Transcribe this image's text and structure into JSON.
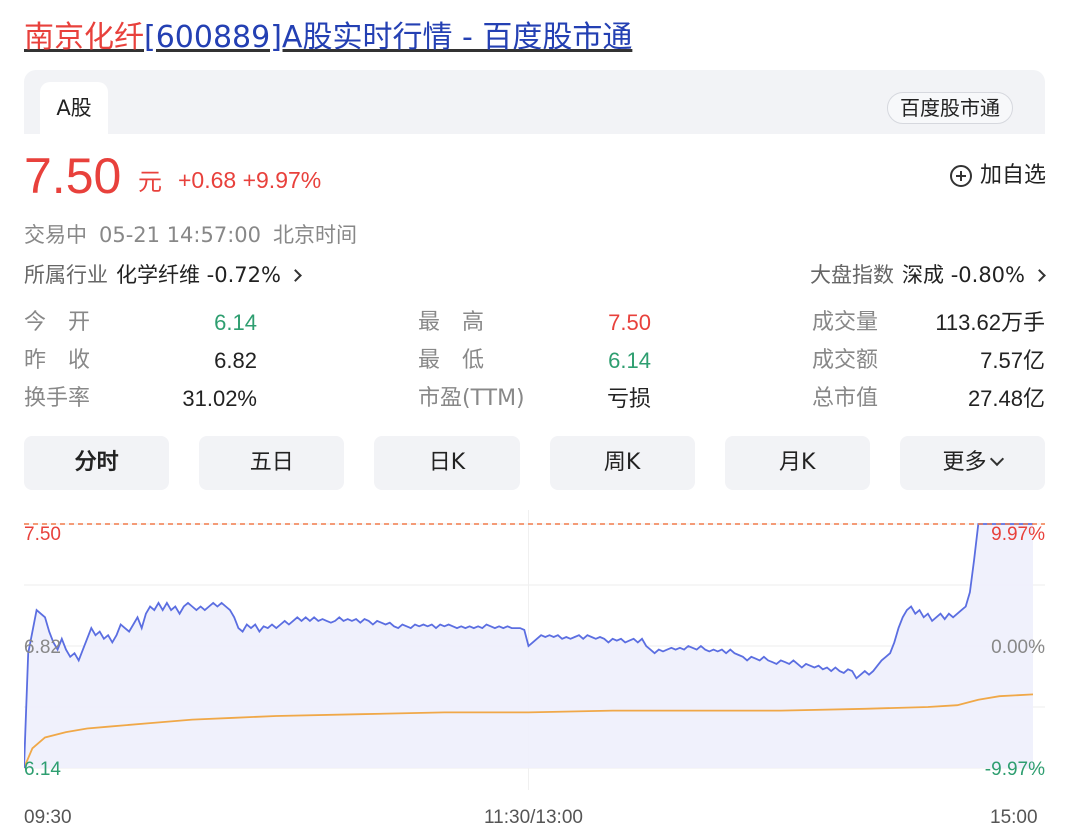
{
  "header": {
    "title_red": "南京化纤",
    "title_blue": "[600889]A股实时行情 - 百度股市通"
  },
  "card": {
    "tab_label": "A股",
    "brand_label": "百度股市通"
  },
  "quote": {
    "price": "7.50",
    "unit": "元",
    "change": "+0.68 +9.97%",
    "add_watch_label": "加自选"
  },
  "status": {
    "state": "交易中",
    "datetime": "05-21 14:57:00",
    "timezone": "北京时间"
  },
  "industry": {
    "label": "所属行业",
    "value": "化学纤维 -0.72%"
  },
  "index": {
    "label": "大盘指数",
    "value": "深成 -0.80%"
  },
  "stats": [
    [
      {
        "label": "今　开",
        "value": "6.14",
        "tone": "green"
      },
      {
        "label": "最　高",
        "value": "7.50",
        "tone": "red"
      },
      {
        "label": "成交量",
        "value": "113.62万手",
        "tone": "dark"
      }
    ],
    [
      {
        "label": "昨　收",
        "value": "6.82",
        "tone": "dark"
      },
      {
        "label": "最　低",
        "value": "6.14",
        "tone": "green"
      },
      {
        "label": "成交额",
        "value": "7.57亿",
        "tone": "dark"
      }
    ],
    [
      {
        "label": "换手率",
        "value": "31.02%",
        "tone": "dark"
      },
      {
        "label": "市盈(TTM)",
        "value": "亏损",
        "tone": "dark"
      },
      {
        "label": "总市值",
        "value": "27.48亿",
        "tone": "dark"
      }
    ]
  ],
  "period_tabs": [
    "分时",
    "五日",
    "日K",
    "周K",
    "月K",
    "更多"
  ],
  "chart_data": {
    "type": "line",
    "y_left_labels": {
      "high": "7.50",
      "mid": "6.82",
      "low": "6.14"
    },
    "y_right_labels": {
      "high": "9.97%",
      "mid": "0.00%",
      "low": "-9.97%"
    },
    "x_labels": [
      "09:30",
      "11:30/13:00",
      "15:00"
    ],
    "ylim": [
      6.14,
      7.5
    ],
    "prev_close": 6.82,
    "x_range": [
      0,
      240
    ],
    "grid": true,
    "series": [
      {
        "values": [
          [
            0,
            6.14
          ],
          [
            1,
            6.78
          ],
          [
            3,
            7.02
          ],
          [
            5,
            6.98
          ],
          [
            6,
            6.9
          ],
          [
            7,
            6.84
          ],
          [
            8,
            6.8
          ],
          [
            9,
            6.86
          ],
          [
            10,
            6.8
          ],
          [
            11,
            6.76
          ],
          [
            12,
            6.78
          ],
          [
            13,
            6.74
          ],
          [
            14,
            6.8
          ],
          [
            15,
            6.86
          ],
          [
            16,
            6.92
          ],
          [
            17,
            6.88
          ],
          [
            18,
            6.9
          ],
          [
            19,
            6.86
          ],
          [
            20,
            6.88
          ],
          [
            21,
            6.84
          ],
          [
            22,
            6.88
          ],
          [
            23,
            6.94
          ],
          [
            24,
            6.92
          ],
          [
            25,
            6.9
          ],
          [
            26,
            6.94
          ],
          [
            27,
            6.98
          ],
          [
            28,
            6.92
          ],
          [
            29,
            7.0
          ],
          [
            30,
            7.04
          ],
          [
            31,
            7.02
          ],
          [
            32,
            7.06
          ],
          [
            33,
            7.02
          ],
          [
            34,
            7.06
          ],
          [
            35,
            7.02
          ],
          [
            36,
            7.04
          ],
          [
            37,
            7.0
          ],
          [
            38,
            7.04
          ],
          [
            39,
            7.06
          ],
          [
            40,
            7.04
          ],
          [
            41,
            7.02
          ],
          [
            42,
            7.04
          ],
          [
            43,
            7.02
          ],
          [
            44,
            7.04
          ],
          [
            45,
            7.06
          ],
          [
            46,
            7.04
          ],
          [
            47,
            7.06
          ],
          [
            48,
            7.04
          ],
          [
            49,
            7.02
          ],
          [
            50,
            6.98
          ],
          [
            51,
            6.92
          ],
          [
            52,
            6.9
          ],
          [
            53,
            6.94
          ],
          [
            54,
            6.92
          ],
          [
            55,
            6.94
          ],
          [
            56,
            6.9
          ],
          [
            57,
            6.93
          ],
          [
            58,
            6.92
          ],
          [
            59,
            6.94
          ],
          [
            60,
            6.92
          ],
          [
            61,
            6.94
          ],
          [
            62,
            6.96
          ],
          [
            63,
            6.94
          ],
          [
            64,
            6.96
          ],
          [
            65,
            6.98
          ],
          [
            66,
            6.96
          ],
          [
            67,
            6.98
          ],
          [
            68,
            6.96
          ],
          [
            69,
            6.98
          ],
          [
            70,
            6.96
          ],
          [
            71,
            6.97
          ],
          [
            72,
            6.96
          ],
          [
            73,
            6.95
          ],
          [
            74,
            6.96
          ],
          [
            75,
            6.98
          ],
          [
            76,
            6.96
          ],
          [
            77,
            6.97
          ],
          [
            78,
            6.96
          ],
          [
            79,
            6.97
          ],
          [
            80,
            6.95
          ],
          [
            81,
            6.97
          ],
          [
            82,
            6.96
          ],
          [
            83,
            6.94
          ],
          [
            84,
            6.96
          ],
          [
            85,
            6.95
          ],
          [
            86,
            6.94
          ],
          [
            87,
            6.95
          ],
          [
            88,
            6.93
          ],
          [
            89,
            6.92
          ],
          [
            90,
            6.94
          ],
          [
            91,
            6.93
          ],
          [
            92,
            6.92
          ],
          [
            93,
            6.94
          ],
          [
            94,
            6.93
          ],
          [
            95,
            6.94
          ],
          [
            96,
            6.93
          ],
          [
            97,
            6.94
          ],
          [
            98,
            6.92
          ],
          [
            99,
            6.94
          ],
          [
            100,
            6.93
          ],
          [
            101,
            6.94
          ],
          [
            102,
            6.93
          ],
          [
            103,
            6.92
          ],
          [
            104,
            6.93
          ],
          [
            105,
            6.92
          ],
          [
            106,
            6.93
          ],
          [
            107,
            6.92
          ],
          [
            108,
            6.93
          ],
          [
            109,
            6.92
          ],
          [
            110,
            6.94
          ],
          [
            111,
            6.93
          ],
          [
            112,
            6.92
          ],
          [
            113,
            6.93
          ],
          [
            114,
            6.92
          ],
          [
            115,
            6.93
          ],
          [
            116,
            6.92
          ],
          [
            117,
            6.92
          ],
          [
            118,
            6.92
          ],
          [
            119,
            6.91
          ],
          [
            120,
            6.82
          ],
          [
            121,
            6.84
          ],
          [
            122,
            6.86
          ],
          [
            123,
            6.88
          ],
          [
            124,
            6.87
          ],
          [
            125,
            6.88
          ],
          [
            126,
            6.87
          ],
          [
            127,
            6.88
          ],
          [
            128,
            6.86
          ],
          [
            129,
            6.87
          ],
          [
            130,
            6.86
          ],
          [
            131,
            6.87
          ],
          [
            132,
            6.88
          ],
          [
            133,
            6.86
          ],
          [
            134,
            6.88
          ],
          [
            135,
            6.87
          ],
          [
            136,
            6.86
          ],
          [
            137,
            6.87
          ],
          [
            138,
            6.86
          ],
          [
            139,
            6.84
          ],
          [
            140,
            6.86
          ],
          [
            141,
            6.85
          ],
          [
            142,
            6.86
          ],
          [
            143,
            6.84
          ],
          [
            144,
            6.85
          ],
          [
            145,
            6.86
          ],
          [
            146,
            6.84
          ],
          [
            147,
            6.86
          ],
          [
            148,
            6.82
          ],
          [
            149,
            6.8
          ],
          [
            150,
            6.78
          ],
          [
            151,
            6.8
          ],
          [
            152,
            6.79
          ],
          [
            153,
            6.8
          ],
          [
            154,
            6.81
          ],
          [
            155,
            6.8
          ],
          [
            156,
            6.81
          ],
          [
            157,
            6.8
          ],
          [
            158,
            6.82
          ],
          [
            159,
            6.81
          ],
          [
            160,
            6.8
          ],
          [
            161,
            6.82
          ],
          [
            162,
            6.8
          ],
          [
            163,
            6.79
          ],
          [
            164,
            6.8
          ],
          [
            165,
            6.79
          ],
          [
            166,
            6.8
          ],
          [
            167,
            6.78
          ],
          [
            168,
            6.8
          ],
          [
            169,
            6.78
          ],
          [
            170,
            6.77
          ],
          [
            171,
            6.76
          ],
          [
            172,
            6.74
          ],
          [
            173,
            6.76
          ],
          [
            174,
            6.75
          ],
          [
            175,
            6.74
          ],
          [
            176,
            6.76
          ],
          [
            177,
            6.74
          ],
          [
            178,
            6.73
          ],
          [
            179,
            6.72
          ],
          [
            180,
            6.74
          ],
          [
            181,
            6.73
          ],
          [
            182,
            6.72
          ],
          [
            183,
            6.74
          ],
          [
            184,
            6.72
          ],
          [
            185,
            6.7
          ],
          [
            186,
            6.72
          ],
          [
            187,
            6.71
          ],
          [
            188,
            6.7
          ],
          [
            189,
            6.71
          ],
          [
            190,
            6.69
          ],
          [
            191,
            6.7
          ],
          [
            192,
            6.68
          ],
          [
            193,
            6.7
          ],
          [
            194,
            6.68
          ],
          [
            195,
            6.67
          ],
          [
            196,
            6.69
          ],
          [
            197,
            6.68
          ],
          [
            198,
            6.64
          ],
          [
            199,
            6.66
          ],
          [
            200,
            6.68
          ],
          [
            201,
            6.66
          ],
          [
            202,
            6.68
          ],
          [
            203,
            6.71
          ],
          [
            204,
            6.74
          ],
          [
            205,
            6.76
          ],
          [
            206,
            6.78
          ],
          [
            207,
            6.84
          ],
          [
            208,
            6.92
          ],
          [
            209,
            6.98
          ],
          [
            210,
            7.02
          ],
          [
            211,
            7.04
          ],
          [
            212,
            7.0
          ],
          [
            213,
            7.02
          ],
          [
            214,
            6.98
          ],
          [
            215,
            7.0
          ],
          [
            216,
            6.96
          ],
          [
            217,
            6.98
          ],
          [
            218,
            7.0
          ],
          [
            219,
            6.97
          ],
          [
            220,
            7.0
          ],
          [
            221,
            6.98
          ],
          [
            222,
            7.0
          ],
          [
            223,
            7.02
          ],
          [
            224,
            7.04
          ],
          [
            225,
            7.12
          ],
          [
            226,
            7.3
          ],
          [
            227,
            7.5
          ],
          [
            240,
            7.5
          ]
        ]
      },
      {
        "values": [
          [
            0,
            6.14
          ],
          [
            2,
            6.25
          ],
          [
            5,
            6.31
          ],
          [
            10,
            6.34
          ],
          [
            15,
            6.36
          ],
          [
            20,
            6.37
          ],
          [
            30,
            6.39
          ],
          [
            40,
            6.41
          ],
          [
            50,
            6.42
          ],
          [
            60,
            6.43
          ],
          [
            80,
            6.44
          ],
          [
            100,
            6.45
          ],
          [
            120,
            6.45
          ],
          [
            140,
            6.46
          ],
          [
            160,
            6.46
          ],
          [
            180,
            6.46
          ],
          [
            200,
            6.47
          ],
          [
            215,
            6.48
          ],
          [
            222,
            6.49
          ],
          [
            227,
            6.52
          ],
          [
            232,
            6.54
          ],
          [
            240,
            6.55
          ]
        ]
      }
    ],
    "colors": {
      "price_line": "#5b6ee1",
      "avg_line": "#f0a848",
      "limit_line": "#f07a4a",
      "area": "#eef0fc"
    }
  }
}
